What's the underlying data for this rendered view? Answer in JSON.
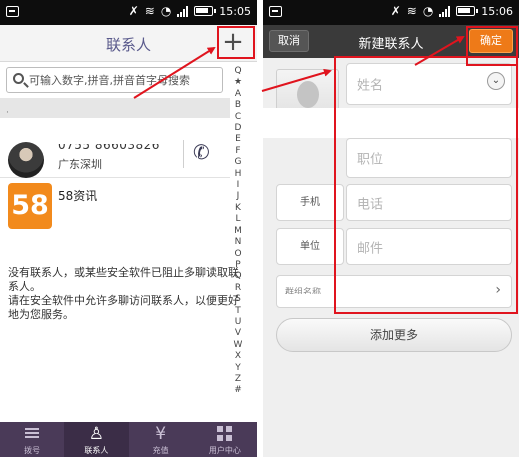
{
  "left": {
    "status_time": "15:05",
    "header_title": "联系人",
    "add_label": "+",
    "search_placeholder": "可输入数字,拼音,拼音首字母搜索",
    "list_dot": "·",
    "contact": {
      "phone": "0755 86603826",
      "location": "广东深圳"
    },
    "app": {
      "logo_text": "58",
      "name": "58资讯"
    },
    "notice_text": "没有联系人，或某些安全软件已阻止多聊读取联系人。\n请在安全软件中允许多聊访问联系人，以便更好地为您服务。",
    "alphabet": [
      "Q",
      "★",
      "A",
      "B",
      "C",
      "D",
      "E",
      "F",
      "G",
      "H",
      "I",
      "J",
      "K",
      "L",
      "M",
      "N",
      "O",
      "P",
      "Q",
      "R",
      "S",
      "T",
      "U",
      "V",
      "W",
      "X",
      "Y",
      "Z",
      "#"
    ],
    "tabs": [
      {
        "label": "拨号",
        "icon": "dialpad-icon"
      },
      {
        "label": "联系人",
        "icon": "contacts-icon"
      },
      {
        "label": "充值",
        "icon": "recharge-yuan-icon"
      },
      {
        "label": "用户中心",
        "icon": "user-center-grid-icon"
      }
    ]
  },
  "right": {
    "status_time": "15:06",
    "cancel_label": "取消",
    "header_title": "新建联系人",
    "confirm_label": "确定",
    "name_placeholder": "姓名",
    "position_placeholder": "职位",
    "mobile_label": "手机",
    "phone_placeholder": "电话",
    "email_type_label": "单位",
    "email_placeholder": "邮件",
    "group_label": "群组名称",
    "add_more_label": "添加更多"
  },
  "colors": {
    "tabbar_bg": "#4a3a58",
    "confirm_orange": "#ee7a18",
    "annotation_red": "#e0141e",
    "logo_58_orange": "#f28a1c"
  }
}
